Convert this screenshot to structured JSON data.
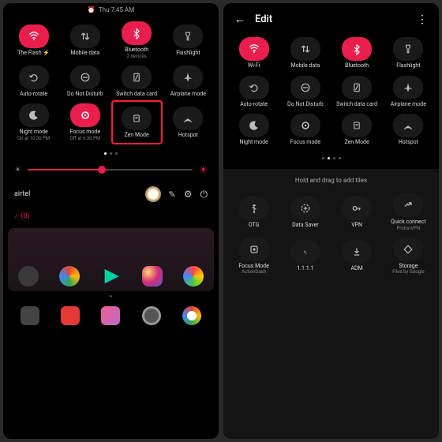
{
  "colors": {
    "accent": "#e91e4d",
    "bg_dark": "#000000",
    "tile": "#1a1a1a",
    "highlight": "#ff2030"
  },
  "left": {
    "status": {
      "time": "Thu 7:45 AM",
      "alarm_icon": "alarm-icon"
    },
    "tiles": [
      {
        "label": "The Flash ⚡",
        "icon": "wifi-icon",
        "active": true,
        "sub": ""
      },
      {
        "label": "Mobile data",
        "icon": "data-arrows-icon",
        "active": false,
        "sub": ""
      },
      {
        "label": "Bluetooth",
        "icon": "bluetooth-icon",
        "active": true,
        "sub": "2 devices"
      },
      {
        "label": "Flashlight",
        "icon": "flashlight-icon",
        "active": false,
        "sub": ""
      },
      {
        "label": "Auto-rotate",
        "icon": "rotate-icon",
        "active": false,
        "sub": ""
      },
      {
        "label": "Do Not Disturb",
        "icon": "dnd-icon",
        "active": false,
        "sub": ""
      },
      {
        "label": "Switch data card",
        "icon": "sim-icon",
        "active": false,
        "sub": ""
      },
      {
        "label": "Airplane mode",
        "icon": "airplane-icon",
        "active": false,
        "sub": ""
      },
      {
        "label": "Night mode",
        "icon": "moon-icon",
        "active": false,
        "sub": "On at 10:30 PM"
      },
      {
        "label": "Focus mode",
        "icon": "focus-icon",
        "active": true,
        "sub": "Off at 6:30 PM"
      },
      {
        "label": "Zen Mode",
        "icon": "zen-icon",
        "active": false,
        "sub": "",
        "highlight": true
      },
      {
        "label": "Hotspot",
        "icon": "hotspot-icon",
        "active": false,
        "sub": ""
      }
    ],
    "brightness": {
      "low_icon": "brightness-low-icon",
      "high_icon": "brightness-high-icon",
      "value": 45
    },
    "carrier": "airtel",
    "music": "(0)",
    "home_apps": [
      "contacts",
      "chrome",
      "play-store",
      "instagram",
      "photos"
    ],
    "dock_apps": [
      "phone",
      "messages",
      "music",
      "camera",
      "chrome"
    ]
  },
  "right": {
    "header": {
      "back_icon": "back-arrow-icon",
      "title": "Edit",
      "more_icon": "more-vert-icon"
    },
    "tiles": [
      {
        "label": "Wi-Fi",
        "icon": "wifi-icon",
        "active": true
      },
      {
        "label": "Mobile data",
        "icon": "data-arrows-icon",
        "active": false
      },
      {
        "label": "Bluetooth",
        "icon": "bluetooth-icon",
        "active": true
      },
      {
        "label": "Flashlight",
        "icon": "flashlight-icon",
        "active": false
      },
      {
        "label": "Auto-rotate",
        "icon": "rotate-icon",
        "active": false
      },
      {
        "label": "Do Not Disturb",
        "icon": "dnd-icon",
        "active": false
      },
      {
        "label": "Switch data card",
        "icon": "sim-icon",
        "active": false
      },
      {
        "label": "Airplane mode",
        "icon": "airplane-icon",
        "active": false
      },
      {
        "label": "Night mode",
        "icon": "moon-icon",
        "active": false
      },
      {
        "label": "Focus mode",
        "icon": "focus-icon",
        "active": false
      },
      {
        "label": "Zen Mode",
        "icon": "zen-icon",
        "active": false
      },
      {
        "label": "Hotspot",
        "icon": "hotspot-icon",
        "active": false
      }
    ],
    "available": {
      "hint": "Hold and drag to add tiles",
      "tiles": [
        {
          "label": "OTG",
          "icon": "usb-icon",
          "sub": ""
        },
        {
          "label": "Data Saver",
          "icon": "datasaver-icon",
          "sub": ""
        },
        {
          "label": "VPN",
          "icon": "key-icon",
          "sub": ""
        },
        {
          "label": "Quick connect",
          "icon": "quickconnect-icon",
          "sub": "ProtonVPN"
        },
        {
          "label": "Focus Mode",
          "icon": "focus2-icon",
          "sub": "ActionDash"
        },
        {
          "label": "1.1.1.1",
          "icon": "dns-icon",
          "sub": ""
        },
        {
          "label": "ADM",
          "icon": "download-icon",
          "sub": ""
        },
        {
          "label": "Storage",
          "icon": "storage-icon",
          "sub": "Files by Google"
        }
      ]
    }
  }
}
